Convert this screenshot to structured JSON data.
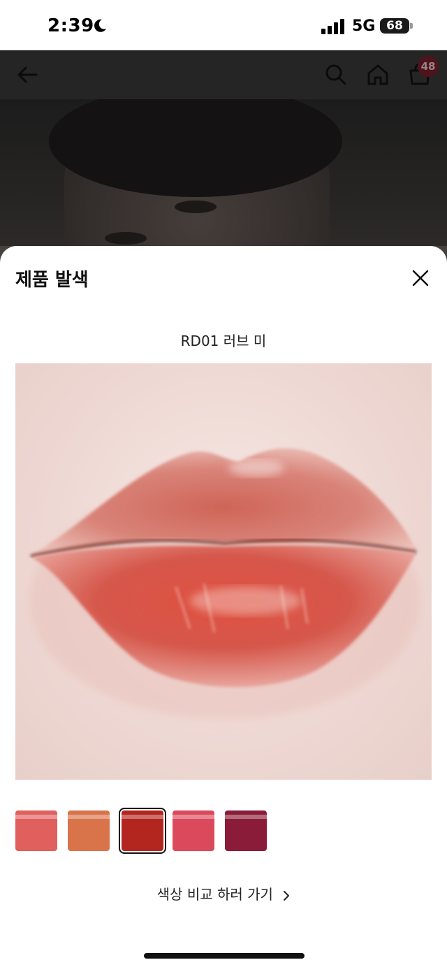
{
  "status_bar": {
    "time": "2:39",
    "network": "5G",
    "battery": "68"
  },
  "header": {
    "cart_count": "48",
    "icons": [
      "back-arrow-icon",
      "search-icon",
      "home-icon",
      "cart-icon"
    ]
  },
  "sheet": {
    "title": "제품 발색",
    "shade_name": "RD01 러브 미",
    "swatches": [
      {
        "color": "#e0605e",
        "selected": false
      },
      {
        "color": "#d9734a",
        "selected": false
      },
      {
        "color": "#b3251f",
        "selected": true
      },
      {
        "color": "#db4a5c",
        "selected": false
      },
      {
        "color": "#8a1c3a",
        "selected": false
      }
    ],
    "compare_link": "색상 비교 하러 가기"
  }
}
